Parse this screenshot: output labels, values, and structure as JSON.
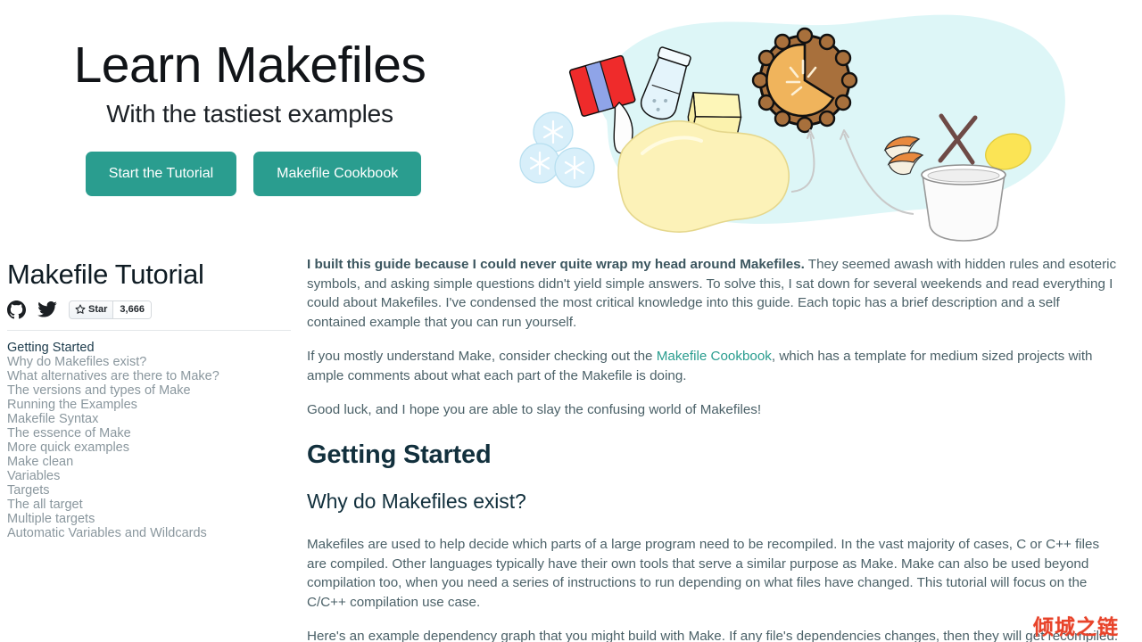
{
  "hero": {
    "title": "Learn Makefiles",
    "subtitle": "With the tastiest examples",
    "primary_button": "Start the Tutorial",
    "secondary_button": "Makefile Cookbook",
    "accent_color": "#2a9d8f",
    "blob_color": "#ddf6f7",
    "illustration": "baking-ingredients-and-pie-illustration"
  },
  "sidebar": {
    "title": "Makefile Tutorial",
    "github_icon": "github-icon",
    "twitter_icon": "twitter-icon",
    "star_button": {
      "icon": "star-icon",
      "label": "Star",
      "count": "3,666"
    },
    "nav": [
      {
        "label": "Getting Started",
        "level": "top",
        "active": true
      },
      {
        "label": "Why do Makefiles exist?",
        "level": "sub"
      },
      {
        "label": "What alternatives are there to Make?",
        "level": "sub"
      },
      {
        "label": "The versions and types of Make",
        "level": "sub"
      },
      {
        "label": "Running the Examples",
        "level": "sub"
      },
      {
        "label": "Makefile Syntax",
        "level": "sub"
      },
      {
        "label": "The essence of Make",
        "level": "sub"
      },
      {
        "label": "More quick examples",
        "level": "sub"
      },
      {
        "label": "Make clean",
        "level": "sub"
      },
      {
        "label": "Variables",
        "level": "sub"
      },
      {
        "label": "Targets",
        "level": "top"
      },
      {
        "label": "The all target",
        "level": "sub"
      },
      {
        "label": "Multiple targets",
        "level": "sub"
      },
      {
        "label": "Automatic Variables and Wildcards",
        "level": "top"
      }
    ]
  },
  "main": {
    "intro_bold": "I built this guide because I could never quite wrap my head around Makefiles.",
    "intro_rest": " They seemed awash with hidden rules and esoteric symbols, and asking simple questions didn't yield simple answers. To solve this, I sat down for several weekends and read everything I could about Makefiles. I've condensed the most critical knowledge into this guide. Each topic has a brief description and a self contained example that you can run yourself.",
    "para2_before": "If you mostly understand Make, consider checking out the ",
    "para2_link": "Makefile Cookbook",
    "para2_after": ", which has a template for medium sized projects with ample comments about what each part of the Makefile is doing.",
    "para3": "Good luck, and I hope you are able to slay the confusing world of Makefiles!",
    "h2": "Getting Started",
    "h3": "Why do Makefiles exist?",
    "para4": "Makefiles are used to help decide which parts of a large program need to be recompiled. In the vast majority of cases, C or C++ files are compiled. Other languages typically have their own tools that serve a similar purpose as Make. Make can also be used beyond compilation too, when you need a series of instructions to run depending on what files have changed. This tutorial will focus on the C/C++ compilation use case.",
    "para5": "Here's an example dependency graph that you might build with Make. If any file's dependencies changes, then they will get recompiled."
  },
  "watermark": {
    "text": "倾城之链",
    "color": "#e8432a"
  }
}
